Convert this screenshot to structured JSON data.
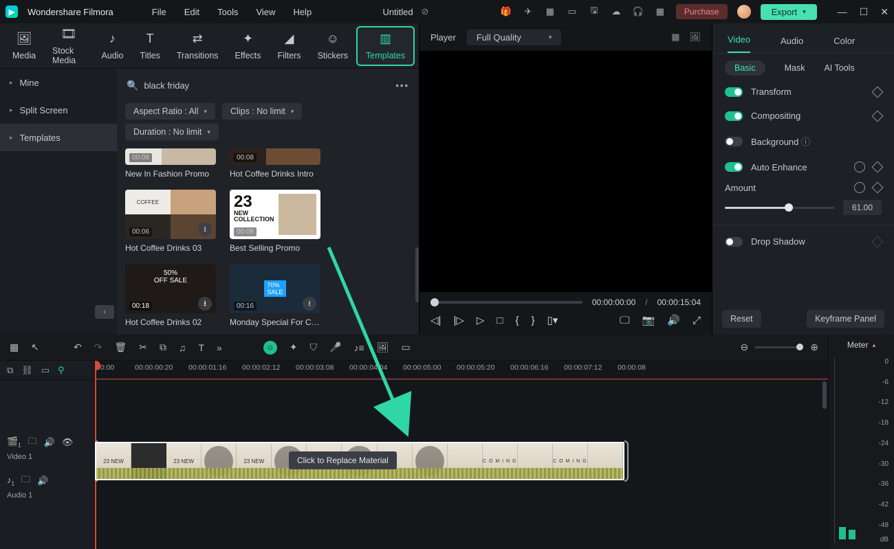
{
  "app": {
    "name": "Wondershare Filmora",
    "title": "Untitled"
  },
  "menus": [
    "File",
    "Edit",
    "Tools",
    "View",
    "Help"
  ],
  "titlebar": {
    "purchase": "Purchase",
    "export": "Export"
  },
  "media_tabs": [
    "Media",
    "Stock Media",
    "Audio",
    "Titles",
    "Transitions",
    "Effects",
    "Filters",
    "Stickers",
    "Templates"
  ],
  "sidebar": {
    "items": [
      "Mine",
      "Split Screen",
      "Templates"
    ],
    "active": 2
  },
  "search": {
    "placeholder": "black friday"
  },
  "filters": {
    "aspect": "Aspect Ratio : All",
    "clips": "Clips : No limit",
    "duration": "Duration : No limit"
  },
  "templates": [
    {
      "dur": "00:08",
      "name": "New In Fashion Promo"
    },
    {
      "dur": "00:08",
      "name": "Hot Coffee Drinks Intro"
    },
    {
      "dur": "00:06",
      "name": "Hot Coffee Drinks 03"
    },
    {
      "dur": "00:08",
      "name": "Best Selling Promo"
    },
    {
      "dur": "00:18",
      "name": "Hot Coffee Drinks 02"
    },
    {
      "dur": "00:16",
      "name": "Monday Special For C…"
    }
  ],
  "preview": {
    "label": "Player",
    "quality": "Full Quality",
    "cur": "00:00:00:00",
    "total": "00:00:15:04"
  },
  "inspector": {
    "tabs": [
      "Video",
      "Audio",
      "Color"
    ],
    "subtabs": [
      "Basic",
      "Mask",
      "AI Tools"
    ],
    "props": {
      "transform": "Transform",
      "compositing": "Compositing",
      "background": "Background",
      "auto_enhance": "Auto Enhance",
      "amount_label": "Amount",
      "amount_value": "61.00",
      "drop_shadow": "Drop Shadow"
    },
    "footer": {
      "reset": "Reset",
      "keyframe": "Keyframe Panel"
    }
  },
  "timeline": {
    "ruler": [
      "00:00",
      "00:00:00:20",
      "00:00:01:16",
      "00:00:02:12",
      "00:00:03:08",
      "00:00:04:04",
      "00:00:05:00",
      "00:00:05:20",
      "00:00:06:16",
      "00:00:07:12",
      "00:00:08"
    ],
    "video_track": "Video 1",
    "audio_track": "Audio 1",
    "clip_overlay": "Click to Replace Material",
    "meter": {
      "label": "Meter",
      "ticks": [
        "0",
        "-6",
        "-12",
        "-18",
        "-24",
        "-30",
        "-36",
        "-42",
        "-48",
        "dB"
      ]
    },
    "coming": "C O M I N G"
  }
}
